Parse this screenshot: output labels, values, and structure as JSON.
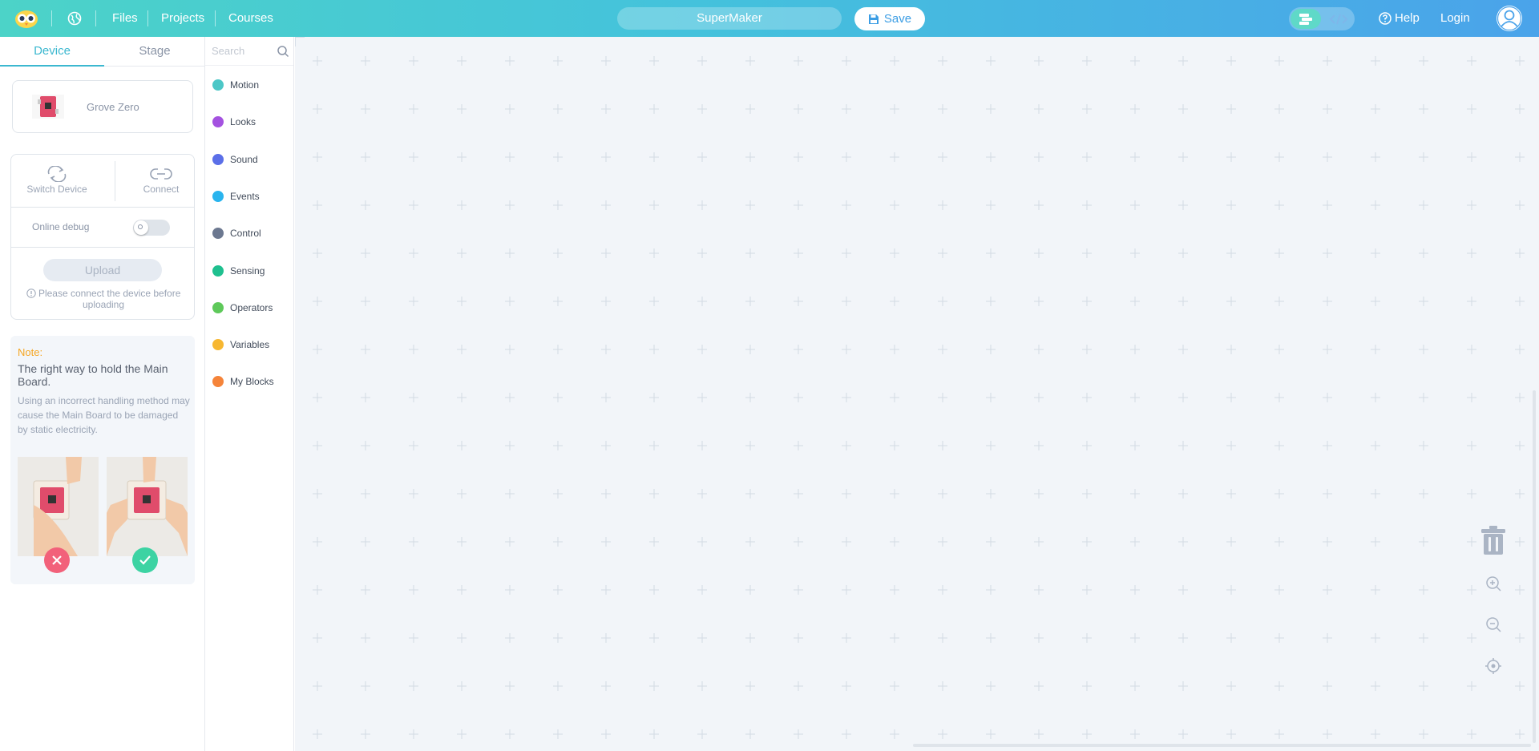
{
  "app": {
    "project_name": "SuperMaker",
    "save_label": "Save",
    "help_label": "Help",
    "login_label": "Login",
    "brand_color": "#44c2dc"
  },
  "nav": {
    "items": [
      {
        "label": "Files"
      },
      {
        "label": "Projects"
      },
      {
        "label": "Courses"
      }
    ]
  },
  "left_panel": {
    "tabs": [
      {
        "label": "Device",
        "active": true
      },
      {
        "label": "Stage",
        "active": false
      }
    ],
    "device": {
      "name": "Grove Zero"
    },
    "switch_device_label": "Switch Device",
    "connect_label": "Connect",
    "online_debug_label": "Online debug",
    "online_debug_on": false,
    "upload_label": "Upload",
    "upload_hint": "Please connect the device before uploading"
  },
  "note": {
    "title": "Note:",
    "heading": "The right way to hold the Main Board.",
    "body": "Using an incorrect handling method may cause the Main Board to be damaged by static electricity."
  },
  "categories": {
    "search_placeholder": "Search",
    "items": [
      {
        "label": "Motion",
        "color": "#4cc7c7"
      },
      {
        "label": "Looks",
        "color": "#a452e0"
      },
      {
        "label": "Sound",
        "color": "#5b6fe8"
      },
      {
        "label": "Events",
        "color": "#29b4ee"
      },
      {
        "label": "Control",
        "color": "#6c7890"
      },
      {
        "label": "Sensing",
        "color": "#1fc08f"
      },
      {
        "label": "Operators",
        "color": "#5ec95a"
      },
      {
        "label": "Variables",
        "color": "#f7b731"
      },
      {
        "label": "My Blocks",
        "color": "#f5843a"
      }
    ]
  },
  "workspace": {
    "tools": [
      "trash-icon",
      "zoom-in-icon",
      "zoom-out-icon",
      "recenter-icon"
    ]
  }
}
